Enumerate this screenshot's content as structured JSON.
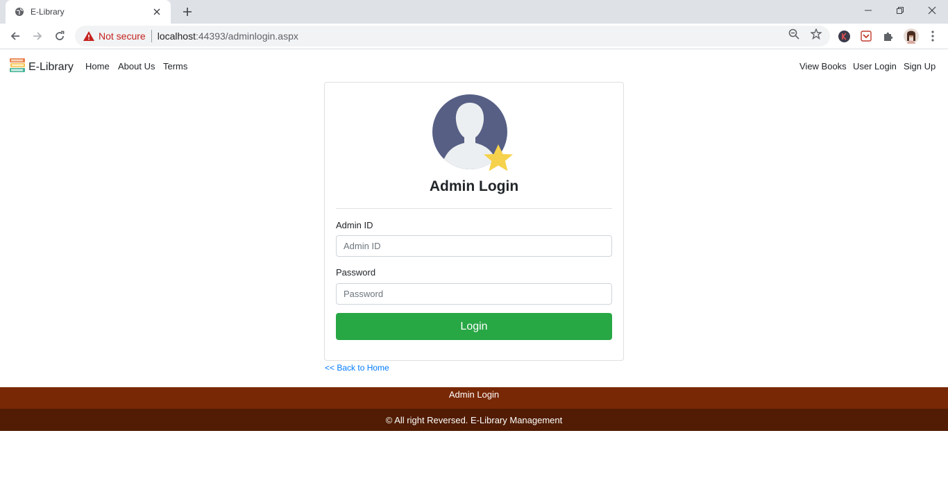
{
  "browser": {
    "tab_title": "E-Library",
    "new_tab": "+",
    "not_secure": "Not secure",
    "url_host": "localhost",
    "url_path": ":44393/adminlogin.aspx"
  },
  "navbar": {
    "brand": "E-Library",
    "left_links": [
      "Home",
      "About Us",
      "Terms"
    ],
    "right_links": [
      "View Books",
      "User Login",
      "Sign Up"
    ]
  },
  "card": {
    "title": "Admin Login",
    "admin_id_label": "Admin ID",
    "admin_id_placeholder": "Admin ID",
    "password_label": "Password",
    "password_placeholder": "Password",
    "login_button": "Login"
  },
  "back_link": "<< Back to Home",
  "footer": {
    "top_link": "Admin Login",
    "copyright": "© All right Reversed. E-Library Management"
  },
  "colors": {
    "login_button": "#28a745",
    "footer_top": "#782805",
    "footer_bottom": "#511c03",
    "link": "#007bff"
  }
}
